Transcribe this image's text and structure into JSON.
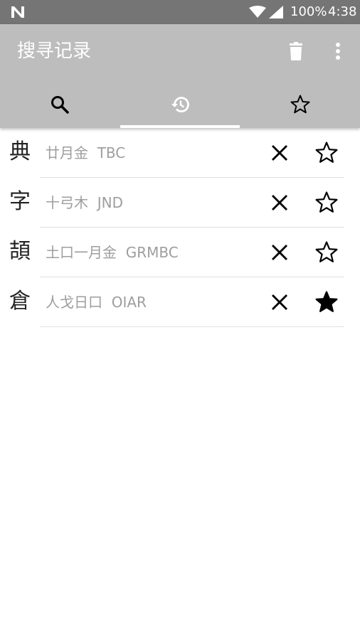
{
  "status_bar": {
    "battery": "100%",
    "time": "4:38",
    "icons": [
      "n-logo-icon",
      "wifi-icon",
      "signal-icon"
    ]
  },
  "app_bar": {
    "title": "搜寻记录",
    "background": "#bdbdbd",
    "actions": [
      "trash-icon",
      "more-vert-icon"
    ]
  },
  "tabs": [
    {
      "icon": "search-icon",
      "selected": false
    },
    {
      "icon": "history-icon",
      "selected": true
    },
    {
      "icon": "star-outline-icon",
      "selected": false
    }
  ],
  "history": [
    {
      "char": "典",
      "components": "廿月金",
      "code": "TBC",
      "starred": false
    },
    {
      "char": "字",
      "components": "十弓木",
      "code": "JND",
      "starred": false
    },
    {
      "char": "頡",
      "components": "土口一月金",
      "code": "GRMBC",
      "starred": false
    },
    {
      "char": "倉",
      "components": "人戈日口",
      "code": "OIAR",
      "starred": true
    }
  ]
}
